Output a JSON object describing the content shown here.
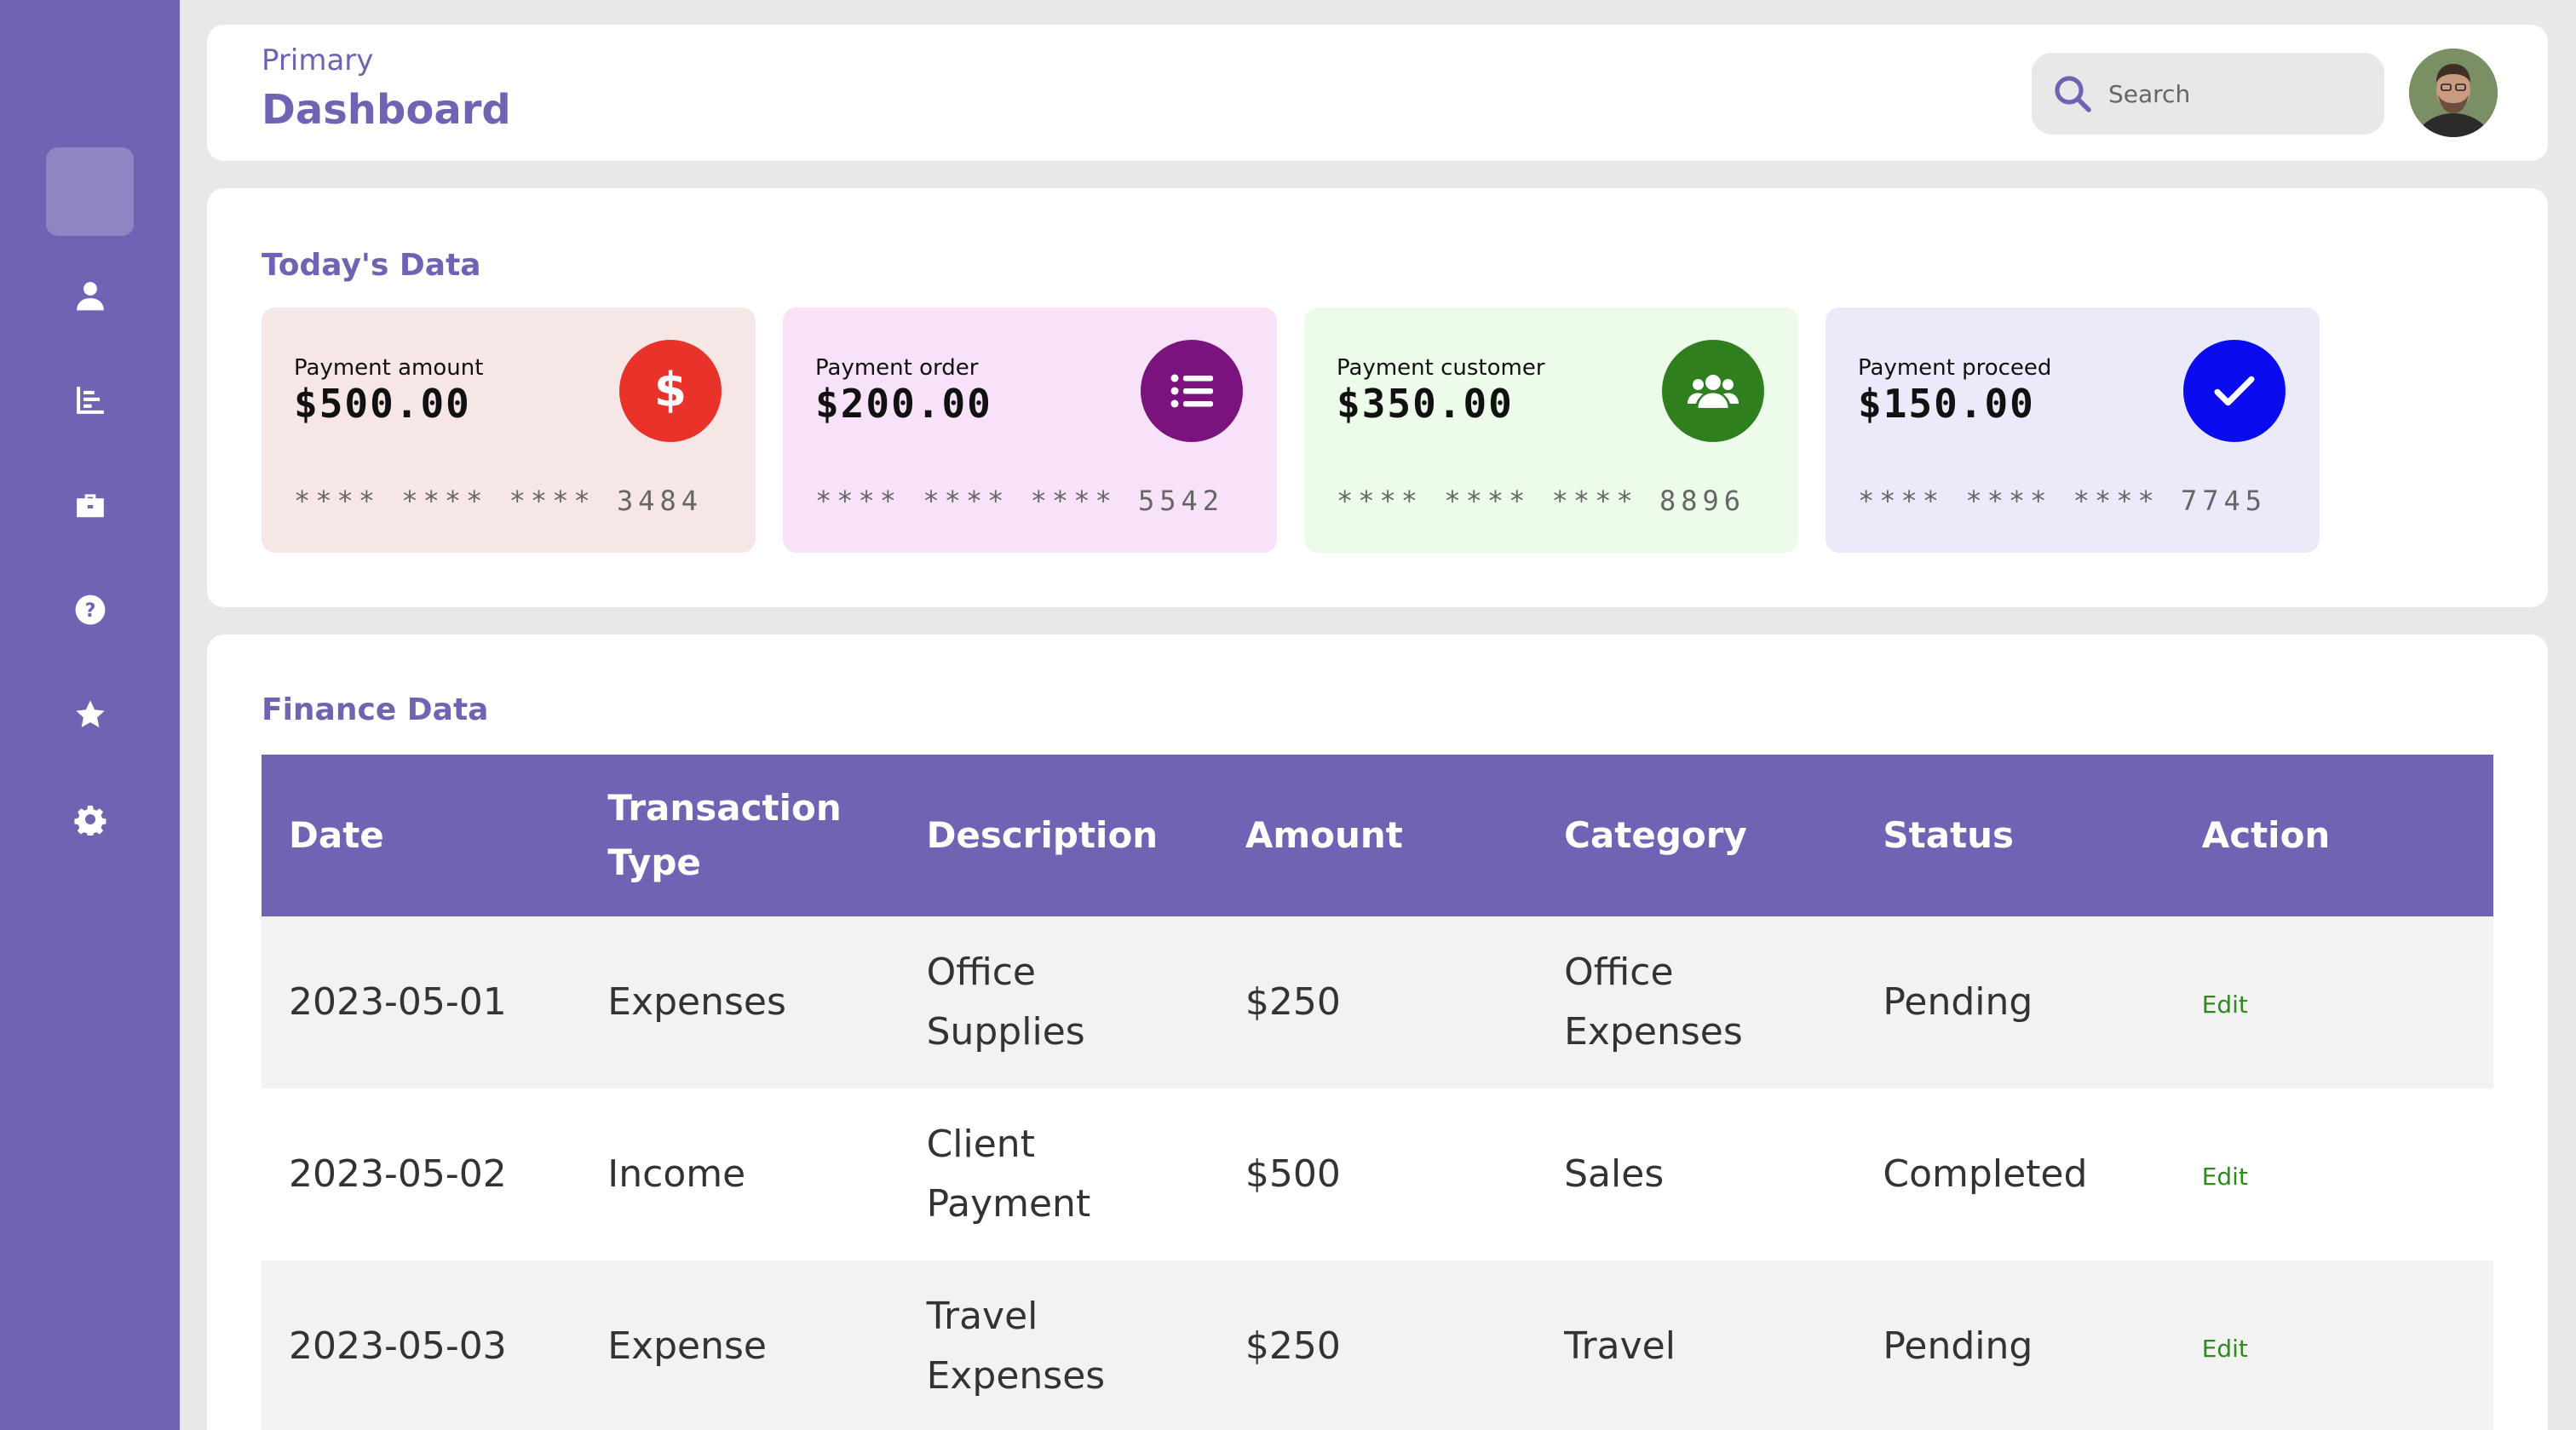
{
  "sidebar": {
    "items": [
      {
        "icon": "user-icon"
      },
      {
        "icon": "chart-icon"
      },
      {
        "icon": "briefcase-icon"
      },
      {
        "icon": "help-icon"
      },
      {
        "icon": "star-icon"
      },
      {
        "icon": "gear-icon"
      }
    ]
  },
  "header": {
    "subtitle": "Primary",
    "title": "Dashboard",
    "search_placeholder": "Search"
  },
  "today": {
    "title": "Today's Data",
    "cards": [
      {
        "label": "Payment amount",
        "value": "$500.00",
        "number": "**** **** **** 3484",
        "icon": "dollar-icon",
        "bg": "#f6e7e6",
        "accent": "#e8322a"
      },
      {
        "label": "Payment order",
        "value": "$200.00",
        "number": "**** **** **** 5542",
        "icon": "list-icon",
        "bg": "#f7e2f9",
        "accent": "#7a137d"
      },
      {
        "label": "Payment customer",
        "value": "$350.00",
        "number": "**** **** **** 8896",
        "icon": "users-icon",
        "bg": "#edfbea",
        "accent": "#2f7f1f"
      },
      {
        "label": "Payment proceed",
        "value": "$150.00",
        "number": "**** **** **** 7745",
        "icon": "check-icon",
        "bg": "#ebeafb",
        "accent": "#0b0bf0"
      }
    ]
  },
  "finance": {
    "title": "Finance Data",
    "columns": [
      "Date",
      "Transaction Type",
      "Description",
      "Amount",
      "Category",
      "Status",
      "Action"
    ],
    "rows": [
      {
        "date": "2023-05-01",
        "type": "Expenses",
        "description": "Office Supplies",
        "amount": "$250",
        "category": "Office Expenses",
        "status": "Pending",
        "action": "Edit"
      },
      {
        "date": "2023-05-02",
        "type": "Income",
        "description": "Client Payment",
        "amount": "$500",
        "category": "Sales",
        "status": "Completed",
        "action": "Edit"
      },
      {
        "date": "2023-05-03",
        "type": "Expense",
        "description": "Travel Expenses",
        "amount": "$250",
        "category": "Travel",
        "status": "Pending",
        "action": "Edit"
      }
    ]
  },
  "colors": {
    "brand": "#7063b3",
    "background": "#e9e7e8",
    "edit_link": "#2f8a1e"
  }
}
